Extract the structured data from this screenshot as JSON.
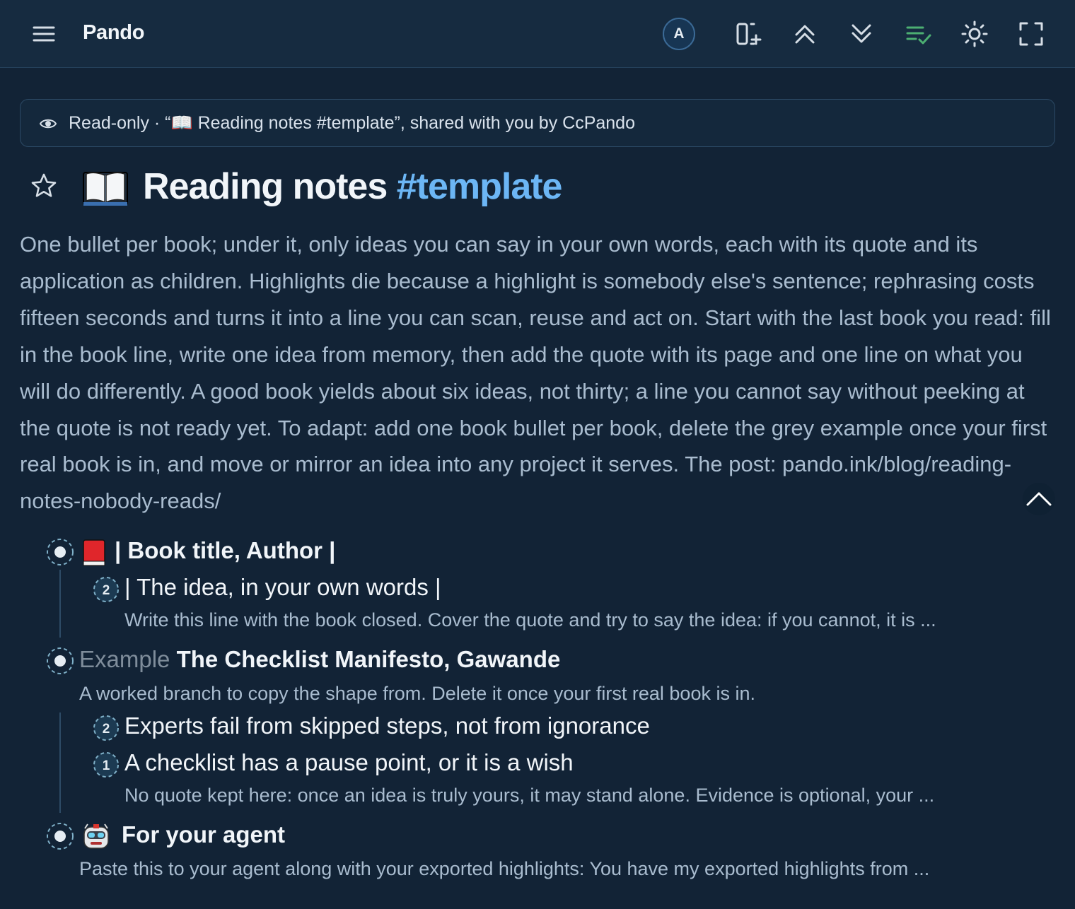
{
  "app": {
    "title": "Pando"
  },
  "toolbar": {
    "avatar_letter": "A",
    "accent": "#4caf72"
  },
  "banner": {
    "text": "Read-only · “📖 Reading notes #template”, shared with you by CcPando"
  },
  "page": {
    "title_icon": "open-book",
    "title_main": "Reading notes ",
    "title_tag": "#template",
    "description": "One bullet per book; under it, only ideas you can say in your own words, each with its quote and its application as children. Highlights die because a highlight is somebody else's sentence; rephrasing costs fifteen seconds and turns it into a line you can scan, reuse and act on. Start with the last book you read: fill in the book line, write one idea from memory, then add the quote with its page and one line on what you will do differently. A good book yields about six ideas, not thirty; a line you cannot say without peeking at the quote is not ready yet. To adapt: add one book bullet per book, delete the grey example once your first real book is in, and move or mirror an idea into any project it serves. The post: pando.ink/blog/reading-notes-nobody-reads/"
  },
  "outline": {
    "book": {
      "icon": "red-book",
      "label": "| Book title, Author |",
      "idea": {
        "count": "2",
        "label": "| The idea, in your own words |",
        "note": "Write this line with the book closed. Cover the quote and try to say the idea: if you cannot, it is ..."
      }
    },
    "example": {
      "prefix": "Example",
      "label": "The Checklist Manifesto, Gawande",
      "note": "A worked branch to copy the shape from. Delete it once your first real book is in.",
      "ideas": [
        {
          "count": "2",
          "label": "Experts fail from skipped steps, not from ignorance"
        },
        {
          "count": "1",
          "label": "A checklist has a pause point, or it is a wish",
          "note": "No quote kept here: once an idea is truly yours, it may stand alone. Evidence is optional, your ..."
        }
      ]
    },
    "agent": {
      "icon": "robot-face",
      "label": "For your agent",
      "note": "Paste this to your agent along with your exported highlights: You have my exported highlights from ..."
    }
  }
}
